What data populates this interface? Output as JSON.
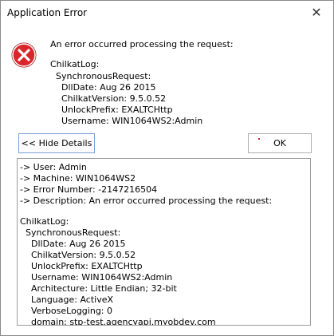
{
  "window": {
    "title": "Application Error",
    "close_glyph": "✕"
  },
  "icons": {
    "error": "error-circle-icon"
  },
  "message": "An error occurred processing the request:",
  "summary": {
    "lines": [
      "ChilkatLog:",
      "  SynchronousRequest:",
      "    DllDate: Aug 26 2015",
      "    ChilkatVersion: 9.5.0.52",
      "    UnlockPrefix: EXALTCHttp",
      "    Username: WIN1064WS2:Admin"
    ]
  },
  "buttons": {
    "hide_details": "<< Hide Details",
    "ok": "OK"
  },
  "details": {
    "lines": [
      "-> User: Admin",
      "-> Machine: WIN1064WS2",
      "-> Error Number: -2147216504",
      "-> Description: An error occurred processing the request:",
      "",
      "ChilkatLog:",
      "  SynchronousRequest:",
      "    DllDate: Aug 26 2015",
      "    ChilkatVersion: 9.5.0.52",
      "    UnlockPrefix: EXALTCHttp",
      "    Username: WIN1064WS2:Admin",
      "    Architecture: Little Endian; 32-bit",
      "    Language: ActiveX",
      "    VerboseLogging: 0",
      "    domain: stp-test.agencyapi.myobdev.com"
    ]
  },
  "colors": {
    "error_red": "#d9262b",
    "button_border_focus": "#7a9fd6"
  }
}
